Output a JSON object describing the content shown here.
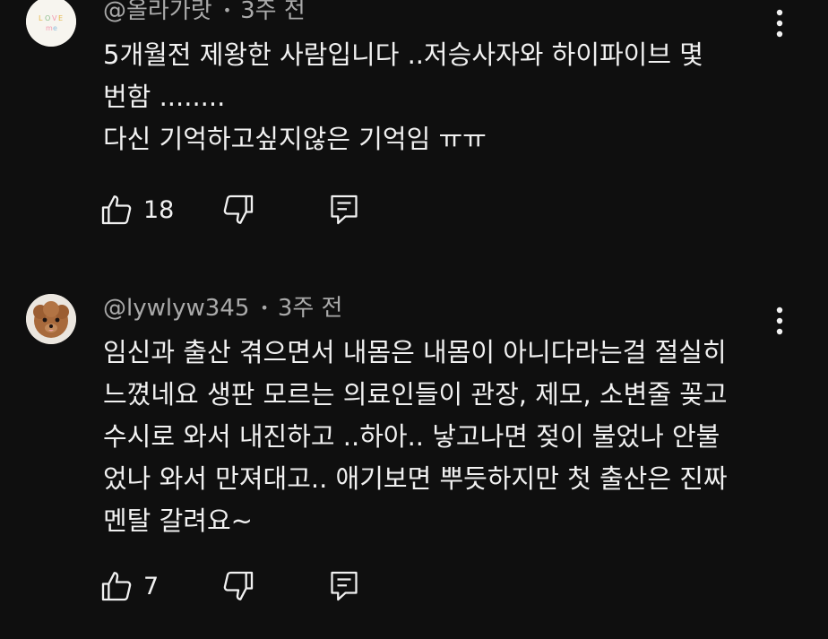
{
  "comments": [
    {
      "author": "@올라가랏",
      "time": "3주 전",
      "lines": [
        "5개월전 제왕한 사람입니다 ..저승사자와  하이파이브 몇",
        "번함 ........",
        "다신 기억하고싶지않은 기억임 ㅠㅠ"
      ],
      "likes": "18",
      "avatar_text": "Love me"
    },
    {
      "author": "@lywlyw345",
      "time": "3주 전",
      "lines": [
        "임신과 출산 겪으면서 내몸은 내몸이 아니다라는걸 절실히",
        "느꼈네요 생판 모르는 의료인들이 관장, 제모, 소변줄 꽂고",
        "수시로 와서 내진하고 ..하아.. 낳고나면 젖이 불었나 안불",
        "었나 와서 만져대고.. 애기보면 뿌듯하지만 첫 출산은 진짜",
        "멘탈 갈려요~"
      ],
      "likes": "7"
    }
  ],
  "meta_separator": "•",
  "icons": {
    "like": "thumbs-up-icon",
    "dislike": "thumbs-down-icon",
    "reply": "reply-comment-icon",
    "more": "more-vert-icon"
  },
  "colors": {
    "background": "#0f0f0f",
    "text": "#f1f1f1",
    "secondary_text": "#aaaaaa"
  }
}
